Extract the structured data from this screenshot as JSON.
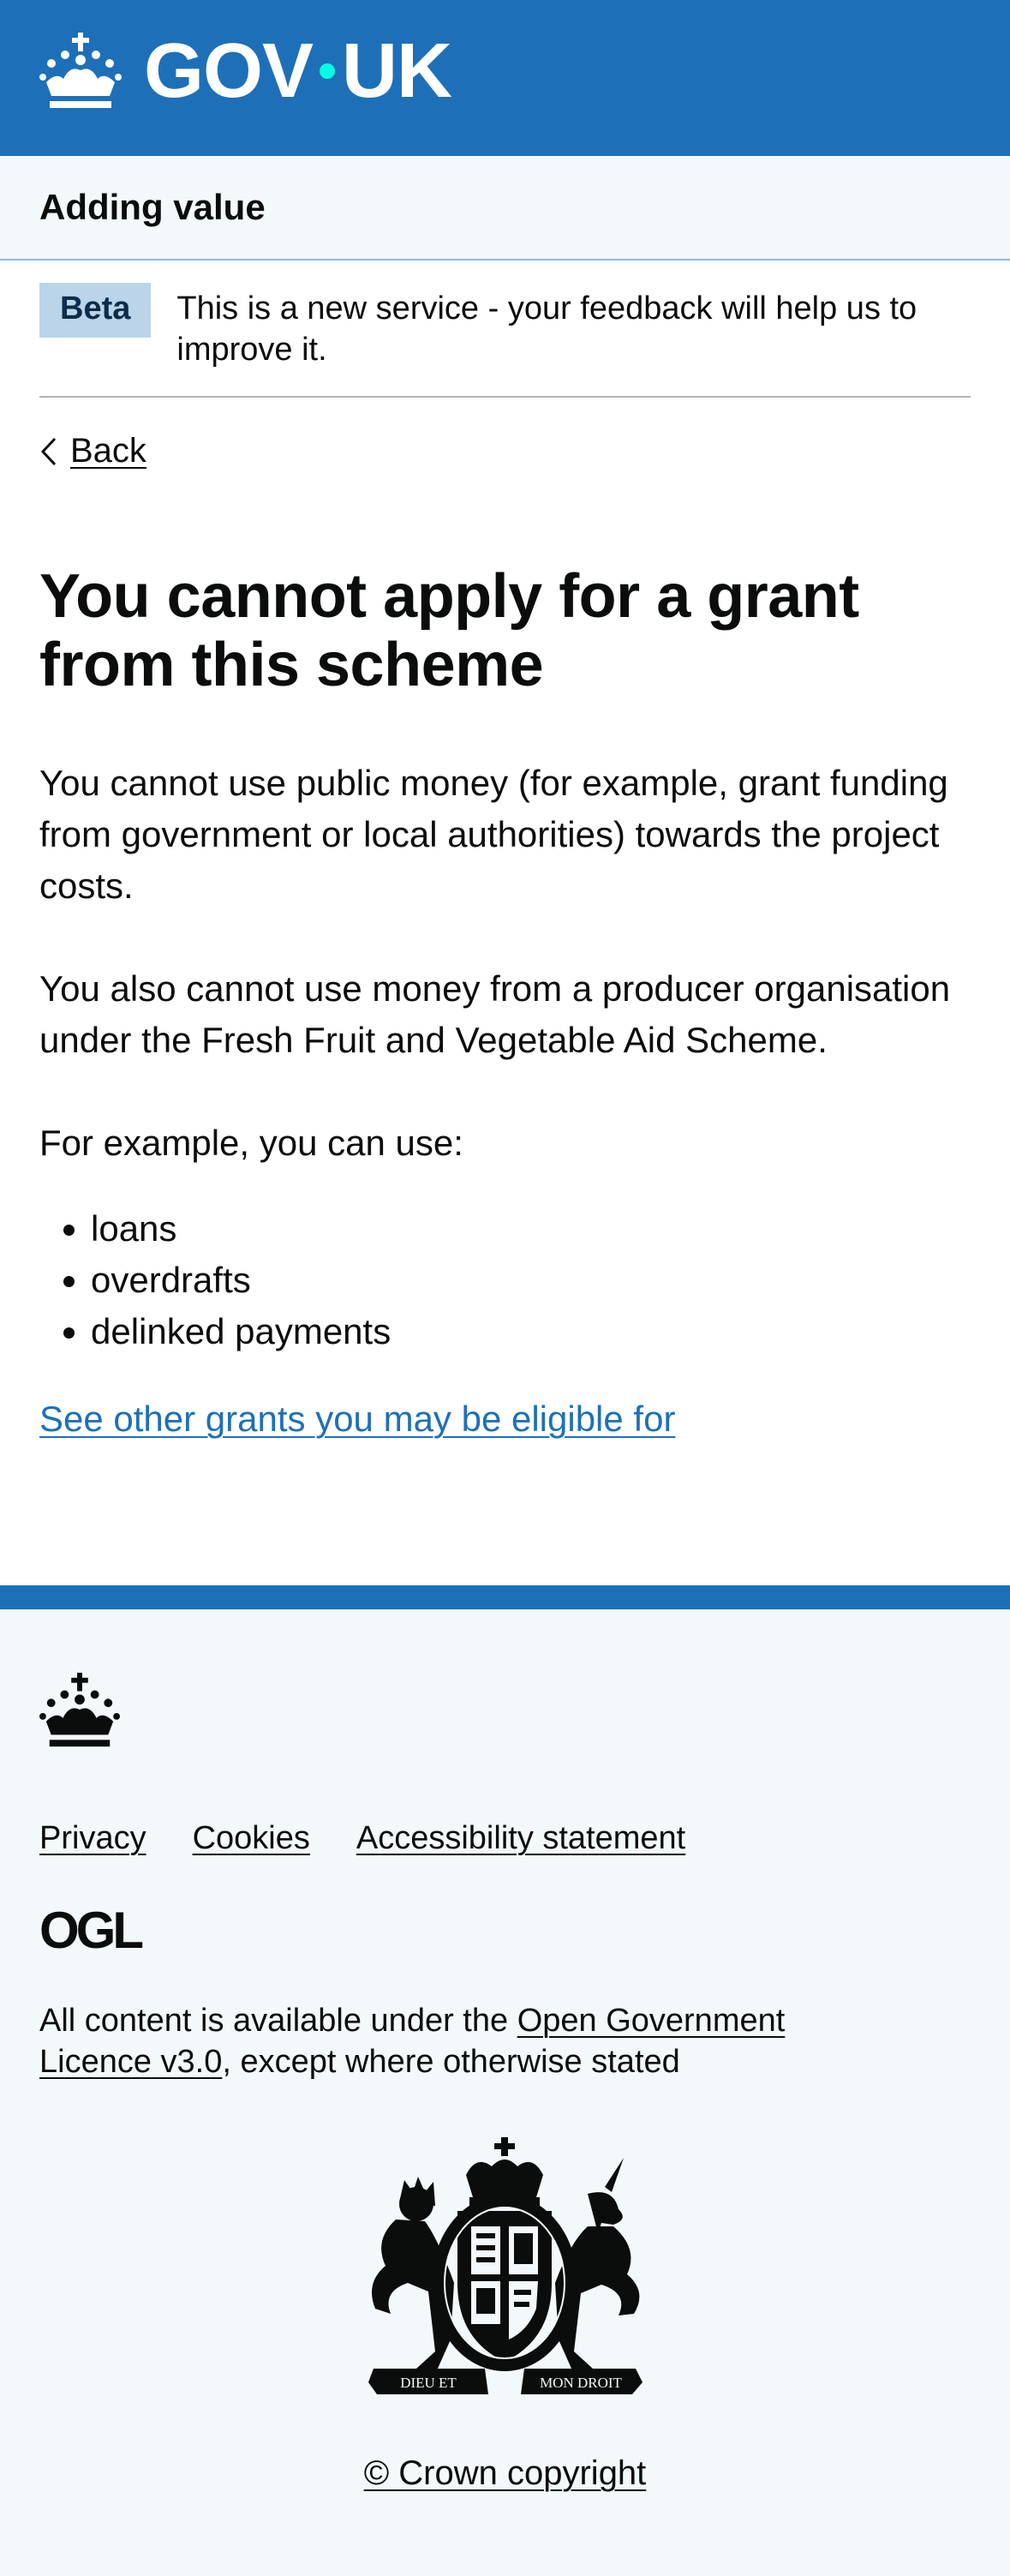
{
  "header": {
    "logo_text_left": "GOV",
    "logo_text_right": "UK",
    "logo_icon": "crown-icon",
    "brand_color": "#1d70b8",
    "dot_color": "#00ffe0"
  },
  "service": {
    "name": "Adding value"
  },
  "phase_banner": {
    "tag": "Beta",
    "text": "This is a new service - your feedback will help us to improve it."
  },
  "back": {
    "label": "Back",
    "icon": "chevron-left-icon"
  },
  "main": {
    "heading": "You cannot apply for a grant from this scheme",
    "paragraph_1": "You cannot use public money (for example, grant funding from government or local authorities) towards the project costs.",
    "paragraph_2": "You also cannot use money from a producer organisation under the Fresh Fruit and Vegetable Aid Scheme.",
    "paragraph_3": "For example, you can use:",
    "list": [
      "loans",
      "overdrafts",
      "delinked payments"
    ],
    "link": "See other grants you may be eligible for"
  },
  "footer": {
    "links": [
      "Privacy",
      "Cookies",
      "Accessibility statement"
    ],
    "ogl_logo": "OGL",
    "licence_prefix": "All content is available under the ",
    "licence_link": "Open Government Licence v3.0",
    "licence_suffix": ", except where otherwise stated",
    "crest_motto_left": "DIEU ET",
    "crest_motto_right": "MON DROIT",
    "copyright": "© Crown copyright"
  }
}
